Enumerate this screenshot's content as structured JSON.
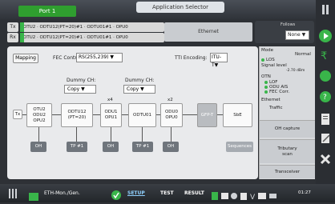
{
  "header": {
    "port_tab": "Port 1",
    "app_title": "Application Selector"
  },
  "lanes": {
    "tx_label": "Tx",
    "rx_label": "Rx",
    "tx_path": "OTU2 · ODTU12(PT=20)#1 · ODTU01#1 · OPU0",
    "rx_path": "OTU2 · ODTU12(PT=20)#1 · ODTU01#1 · OPU0",
    "client": "Ethernet"
  },
  "follows": {
    "label": "Follows",
    "value": "None"
  },
  "toolbar": {
    "mapping_label": "Mapping",
    "fec_label": "FEC Control:",
    "fec_value": "RS(255,239)",
    "tti_label": "TTI Encoding:",
    "tti_value": "ITU-T"
  },
  "dummy": [
    {
      "label": "Dummy CH:",
      "value": "Copy"
    },
    {
      "label": "Dummy CH:",
      "value": "Copy"
    }
  ],
  "multipliers": {
    "m1": "x4",
    "m2": "x2"
  },
  "blocks": {
    "tx": "Tx",
    "otu2": "OTU2\nODU2\nOPU2",
    "odtu12": "ODTU12\n(PT=20)",
    "odu1": "ODU1\nOPU1",
    "odtu01": "ODTU01",
    "odu0": "ODU0\nOPU0",
    "gfpt": "GFP-T",
    "sbe": "SbE"
  },
  "subs": {
    "oh1": "OH",
    "tp1": "TP #1",
    "oh2": "OH",
    "tp2": "TP #1",
    "oh3": "OH",
    "disabled": "Sequences"
  },
  "info": {
    "mode_label": "Mode",
    "mode_value": "Normal",
    "los": "LOS",
    "signal_label": "Signal level",
    "signal_value": "-2.70 dBm",
    "otn_label": "OTN",
    "lof": "LOF",
    "oduais": "ODU AIS",
    "feccorr": "FEC Corr.",
    "eth_label": "Ethernet",
    "traffic": "Traffic",
    "oh_capture": "OH capture",
    "tributary": "Tributary\nscan",
    "transceiver": "Transceiver"
  },
  "bottom": {
    "device": "ETH-Mon./Gen.",
    "setup": "SETUP",
    "test": "TEST",
    "result": "RESULT",
    "time": "01:27"
  },
  "colors": {
    "accent": "#39b54a",
    "panel": "#e9eaec",
    "dark": "#2e3136"
  }
}
